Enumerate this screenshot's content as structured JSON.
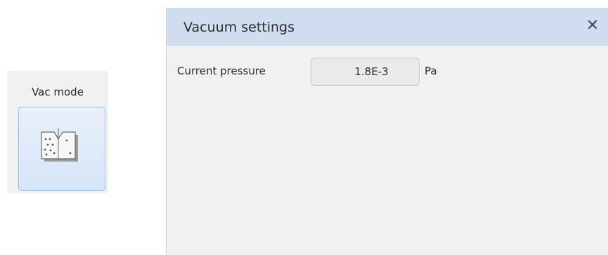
{
  "vac_mode": {
    "title": "Vac mode",
    "button_icon": "vacuum-chamber-icon"
  },
  "dialog": {
    "title": "Vacuum settings",
    "close_icon": "close-icon",
    "close_glyph": "✕",
    "pressure": {
      "label": "Current pressure",
      "value": "1.8E-3",
      "unit": "Pa"
    }
  }
}
